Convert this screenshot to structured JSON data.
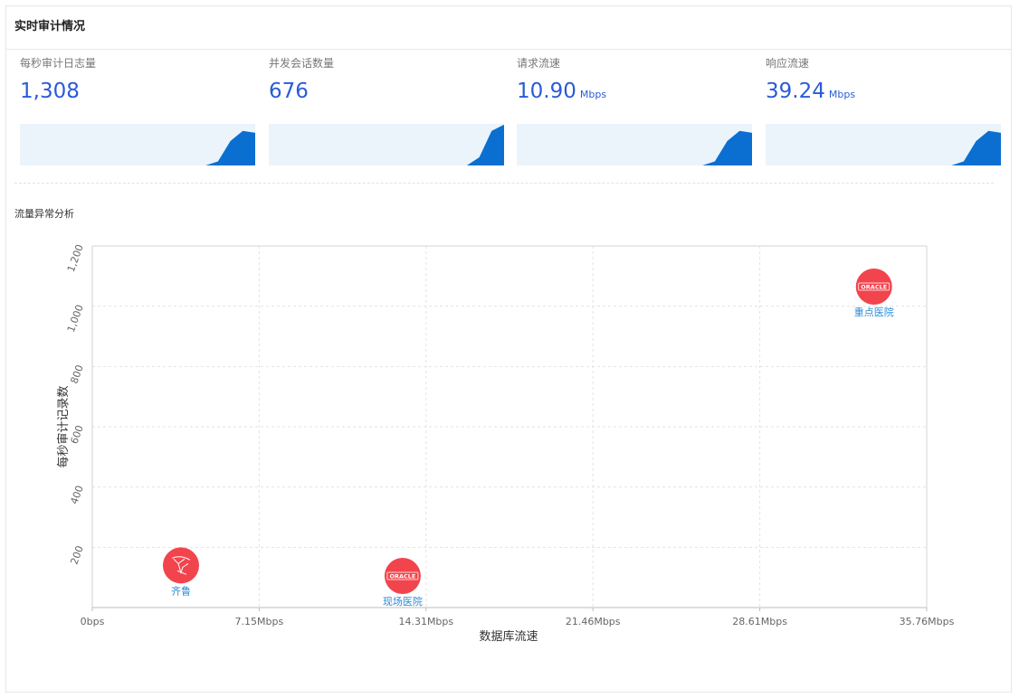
{
  "panel": {
    "title": "实时审计情况"
  },
  "stats": [
    {
      "label": "每秒审计日志量",
      "value": "1,308",
      "unit": "",
      "spark": [
        0,
        0,
        0,
        0,
        0,
        0,
        0,
        0,
        0,
        0,
        0,
        0,
        0,
        0,
        0,
        0,
        0.1,
        0.6,
        0.85,
        0.8
      ]
    },
    {
      "label": "并发会话数量",
      "value": "676",
      "unit": "",
      "spark": [
        0,
        0,
        0,
        0,
        0,
        0,
        0,
        0,
        0,
        0,
        0,
        0,
        0,
        0,
        0,
        0,
        0,
        0.2,
        0.85,
        1.0
      ]
    },
    {
      "label": "请求流速",
      "value": "10.90",
      "unit": "Mbps",
      "spark": [
        0,
        0,
        0,
        0,
        0,
        0,
        0,
        0,
        0,
        0,
        0,
        0,
        0,
        0,
        0,
        0,
        0.1,
        0.6,
        0.85,
        0.8
      ]
    },
    {
      "label": "响应流速",
      "value": "39.24",
      "unit": "Mbps",
      "spark": [
        0,
        0,
        0,
        0,
        0,
        0,
        0,
        0,
        0,
        0,
        0,
        0,
        0,
        0,
        0,
        0,
        0.1,
        0.6,
        0.85,
        0.8
      ]
    }
  ],
  "section": {
    "title": "流量异常分析"
  },
  "colors": {
    "accent": "#2a5bd7",
    "spark_fill": "#0a6fd0",
    "spark_bg": "#ebf3fb",
    "bubble": "#f2444d",
    "bubble_label": "#2a8bd8"
  },
  "chart_data": {
    "type": "scatter",
    "xlabel": "数据库流速",
    "ylabel": "每秒审计记录数",
    "x_ticks": [
      "0bps",
      "7.15Mbps",
      "14.31Mbps",
      "21.46Mbps",
      "28.61Mbps",
      "35.76Mbps"
    ],
    "y_ticks": [
      "200",
      "400",
      "600",
      "800",
      "1,000",
      "1,200"
    ],
    "xlim": [
      0,
      35.76
    ],
    "ylim": [
      0,
      1200
    ],
    "grid": true,
    "points": [
      {
        "name": "齐鲁",
        "x": 3.8,
        "y": 140,
        "icon": "mysql-dolphin-icon"
      },
      {
        "name": "现场医院",
        "x": 13.3,
        "y": 105,
        "icon": "oracle-logo",
        "logo_text": "ORACLE"
      },
      {
        "name": "重点医院",
        "x": 33.5,
        "y": 1065,
        "icon": "oracle-logo",
        "logo_text": "ORACLE"
      }
    ]
  }
}
